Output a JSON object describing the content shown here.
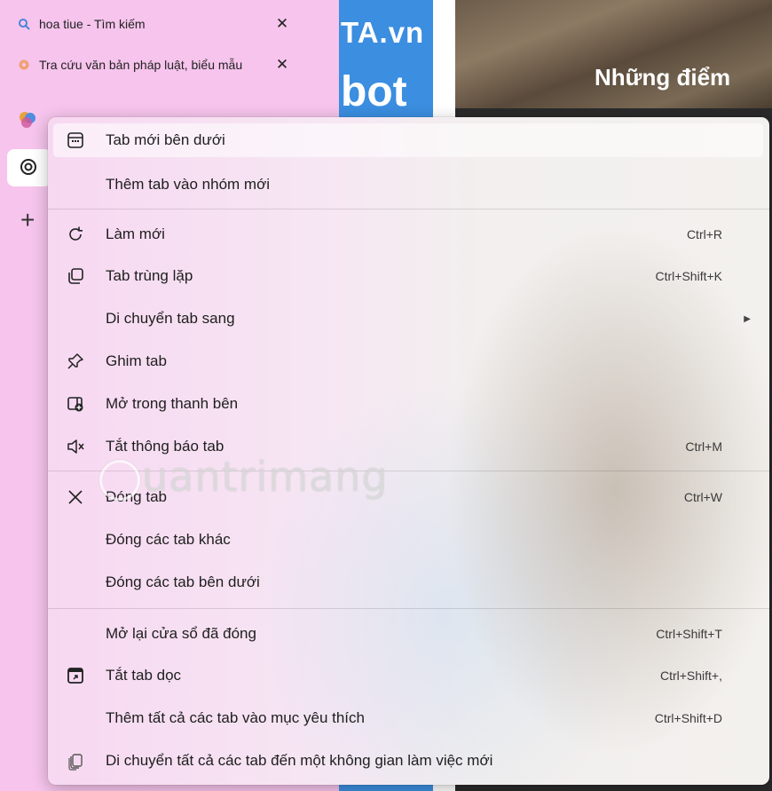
{
  "tabs": [
    {
      "title": "hoa tiue - Tìm kiếm",
      "close": "✕"
    },
    {
      "title": "Tra cứu văn bản pháp luật, biểu mẫu",
      "close": "✕"
    }
  ],
  "new_tab_symbol": "+",
  "page": {
    "brand_top": "TA.vn",
    "brand_bottom": "bot",
    "headline": "Những điểm"
  },
  "watermark": "uantrimang",
  "menu": {
    "items": [
      {
        "label": "Tab mới bên dưới",
        "shortcut": "",
        "icon": "new-tab-below-icon"
      },
      {
        "label": "Thêm tab vào nhóm mới",
        "shortcut": "",
        "icon": ""
      },
      {
        "label": "Làm mới",
        "shortcut": "Ctrl+R",
        "icon": "refresh-icon"
      },
      {
        "label": "Tab trùng lặp",
        "shortcut": "Ctrl+Shift+K",
        "icon": "duplicate-icon"
      },
      {
        "label": "Di chuyển tab sang",
        "shortcut": "",
        "icon": "",
        "submenu": "▶"
      },
      {
        "label": "Ghim tab",
        "shortcut": "",
        "icon": "pin-icon"
      },
      {
        "label": "Mở trong thanh bên",
        "shortcut": "",
        "icon": "sidebar-open-icon"
      },
      {
        "label": "Tắt thông báo tab",
        "shortcut": "Ctrl+M",
        "icon": "mute-icon"
      },
      {
        "label": "Đóng tab",
        "shortcut": "Ctrl+W",
        "icon": "close-icon"
      },
      {
        "label": "Đóng các tab khác",
        "shortcut": "",
        "icon": ""
      },
      {
        "label": "Đóng các tab bên dưới",
        "shortcut": "",
        "icon": ""
      },
      {
        "label": "Mở lại cửa sổ đã đóng",
        "shortcut": "Ctrl+Shift+T",
        "icon": ""
      },
      {
        "label": "Tắt tab dọc",
        "shortcut": "Ctrl+Shift+,",
        "icon": "vertical-tabs-icon"
      },
      {
        "label": "Thêm tất cả các tab vào mục yêu thích",
        "shortcut": "Ctrl+Shift+D",
        "icon": ""
      },
      {
        "label": "Di chuyển tất cả các tab đến một không gian làm việc mới",
        "shortcut": "",
        "icon": "workspace-icon"
      }
    ]
  }
}
